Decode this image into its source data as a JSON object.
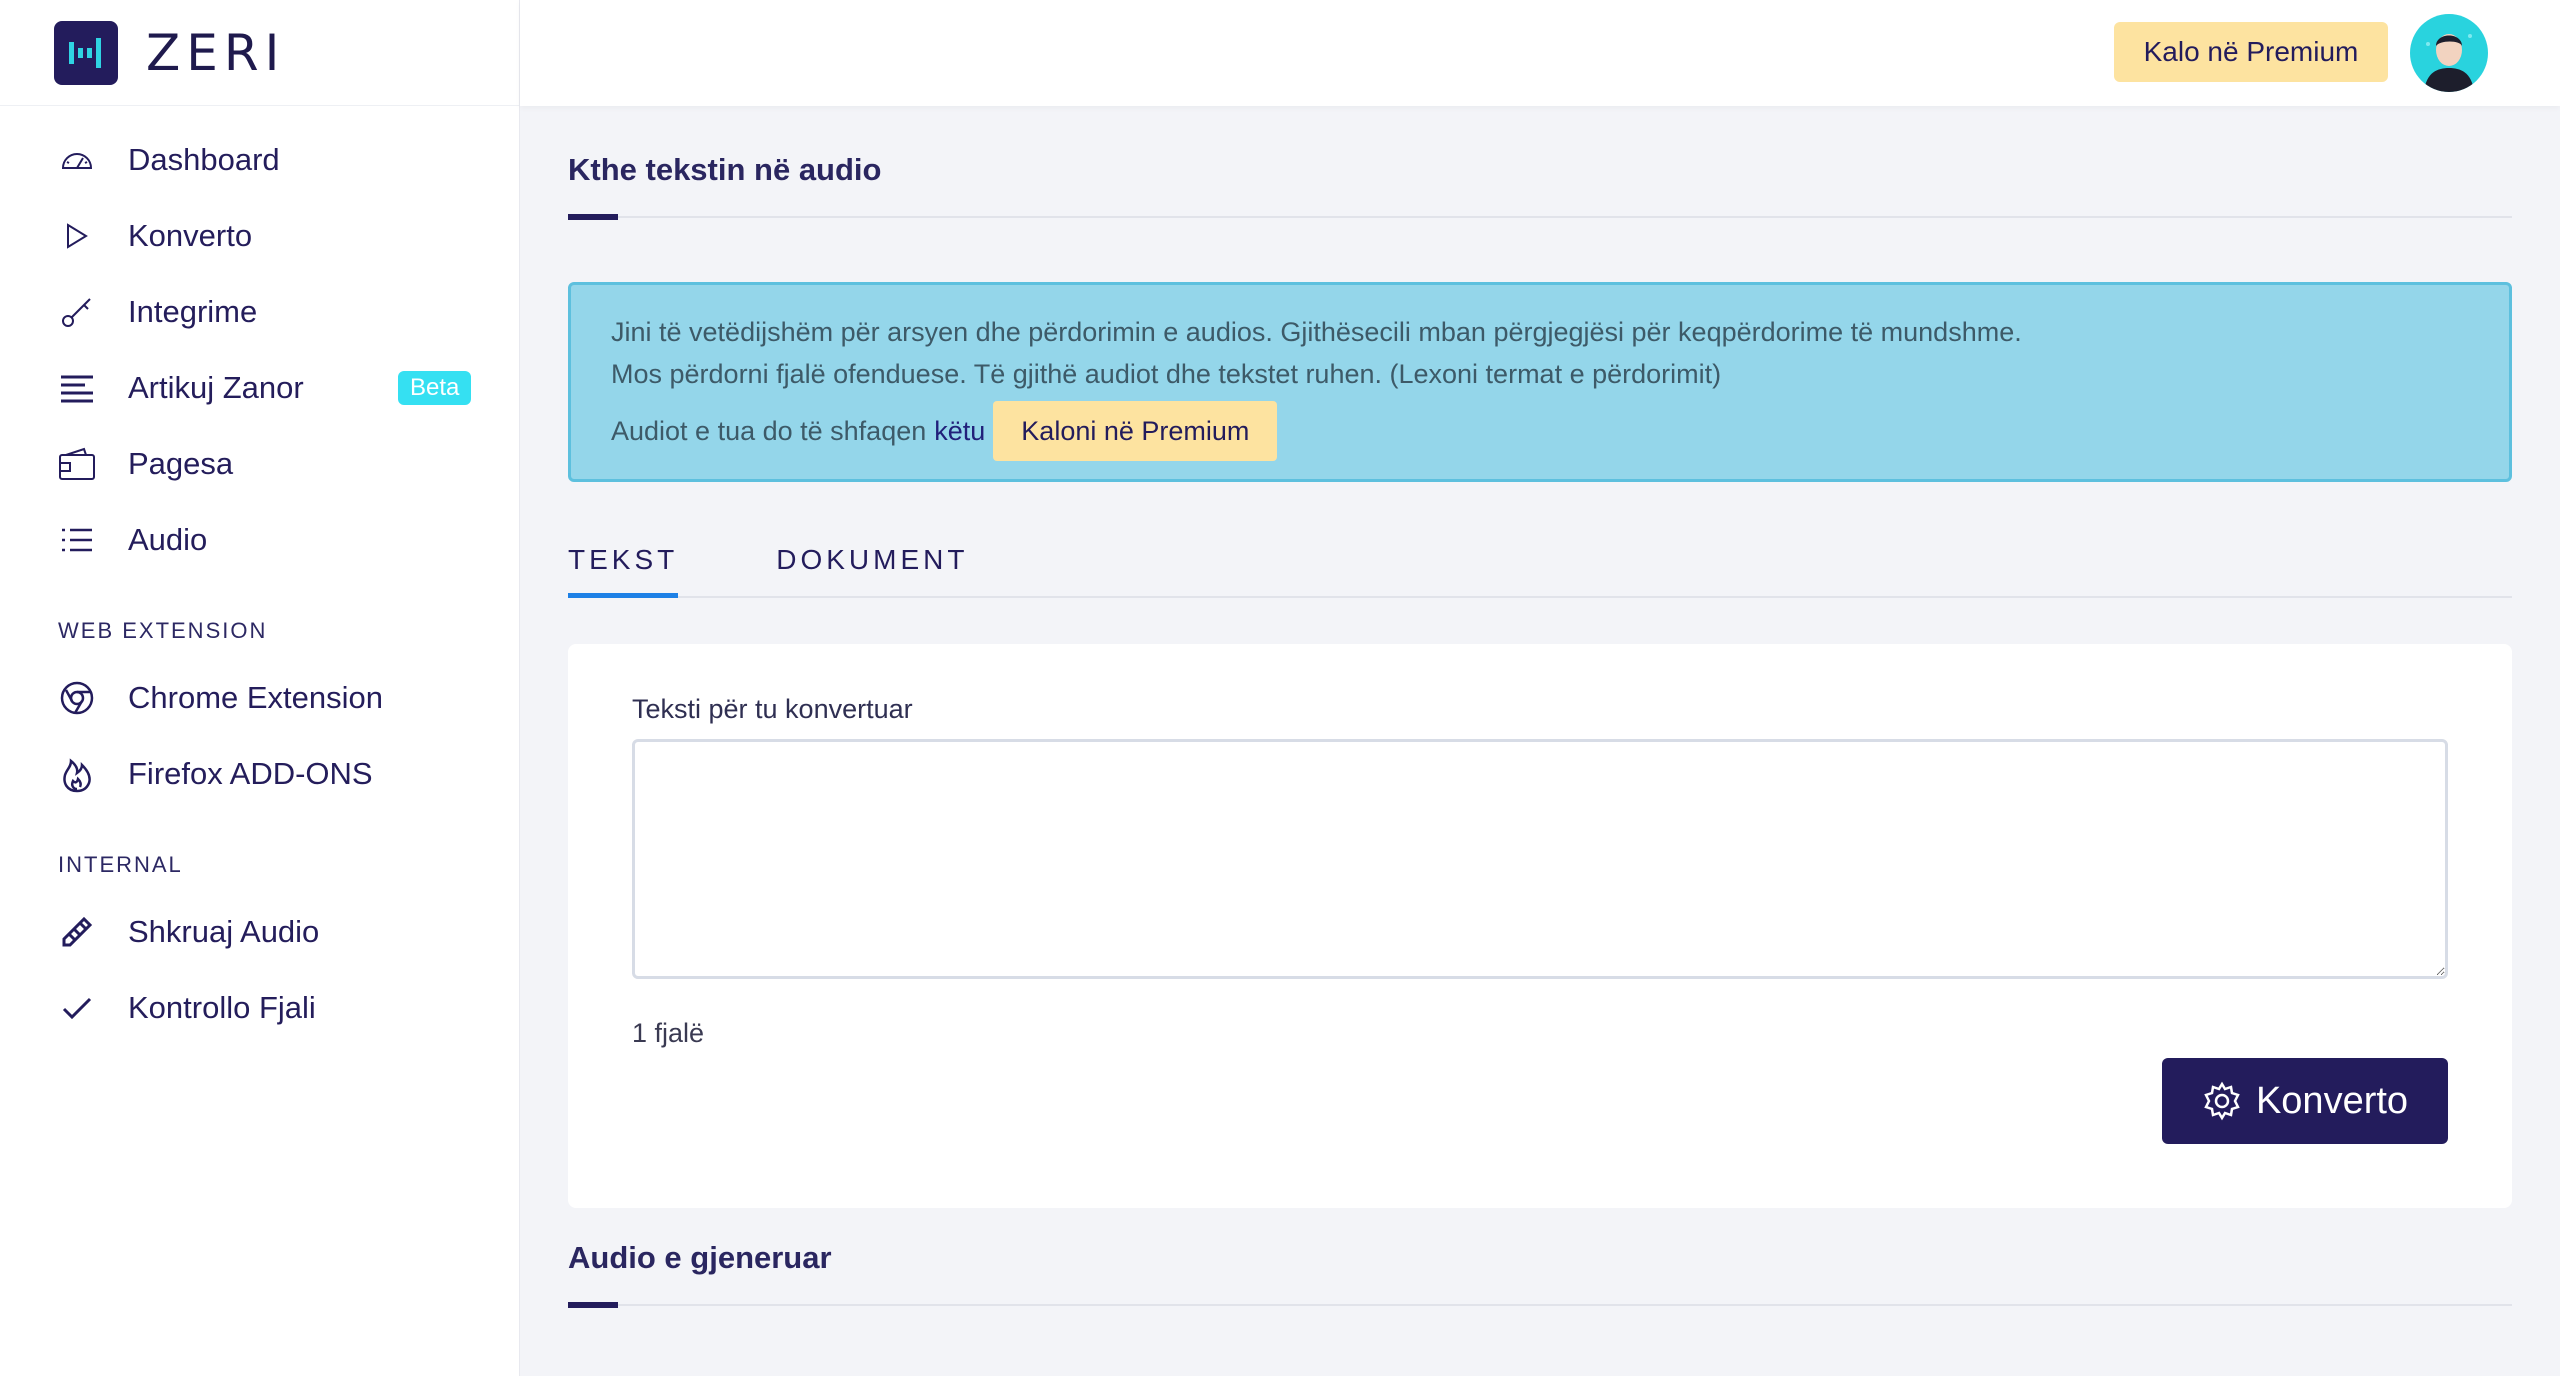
{
  "brand": {
    "name": "ZERI"
  },
  "colors": {
    "primary": "#231c5c",
    "premium": "#fde3a0",
    "alert_bg": "#94d6ea",
    "badge": "#35e0f2",
    "tab_active": "#1d80e6"
  },
  "sidebar": {
    "items": [
      {
        "label": "Dashboard",
        "icon": "gauge-icon"
      },
      {
        "label": "Konverto",
        "icon": "play-icon"
      },
      {
        "label": "Integrime",
        "icon": "key-icon"
      },
      {
        "label": "Artikuj Zanor",
        "icon": "article-icon",
        "badge": "Beta"
      },
      {
        "label": "Pagesa",
        "icon": "wallet-icon"
      },
      {
        "label": "Audio",
        "icon": "list-icon"
      }
    ],
    "web_extension": {
      "title": "WEB EXTENSION",
      "items": [
        {
          "label": "Chrome Extension",
          "icon": "chrome-icon"
        },
        {
          "label": "Firefox ADD-ONS",
          "icon": "fire-icon"
        }
      ]
    },
    "internal": {
      "title": "INTERNAL",
      "items": [
        {
          "label": "Shkruaj Audio",
          "icon": "pencil-icon"
        },
        {
          "label": "Kontrollo Fjali",
          "icon": "check-icon"
        }
      ]
    }
  },
  "header": {
    "premium_button": "Kalo në Premium"
  },
  "main": {
    "title": "Kthe tekstin në audio",
    "alert": {
      "line1": "Jini të vetëdijshëm për arsyen dhe përdorimin e audios. Gjithësecili mban përgjegjësi për keqpërdorime të mundshme.",
      "line2": "Mos përdorni fjalë ofenduese. Të gjithë audiot dhe tekstet ruhen. (Lexoni termat e përdorimit)",
      "line3_text": "Audiot e tua do të shfaqen",
      "line3_link": "këtu",
      "button": "Kaloni në Premium"
    },
    "tabs": [
      "TEKST",
      "DOKUMENT"
    ],
    "form": {
      "label": "Teksti për tu konvertuar",
      "value": "",
      "placeholder": "",
      "word_count": "1 fjalë",
      "convert_button": "Konverto"
    },
    "generated_title": "Audio e gjeneruar"
  }
}
